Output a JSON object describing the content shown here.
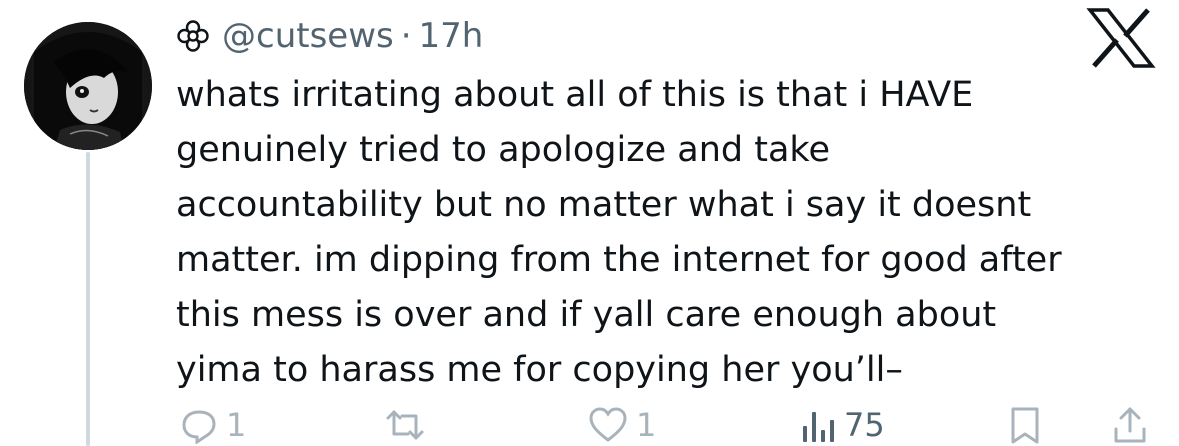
{
  "tweet": {
    "handle": "@cutsews",
    "separator": "·",
    "time": "17h",
    "text_lines": [
      "whats irritating about all of this is that i HAVE",
      "genuinely tried to apologize and take",
      "accountability but no matter what i say it doesnt",
      "matter. im dipping from the internet for good after",
      "this mess is over and if yall care enough about",
      "yima to harass me for copying her you’ll–"
    ],
    "actions": {
      "reply_count": "1",
      "retweet_count": "",
      "like_count": "1",
      "view_count": "75"
    }
  },
  "icons": {
    "handle_prefix": "flower-icon",
    "brand": "x-logo-icon",
    "reply": "reply-icon",
    "retweet": "retweet-icon",
    "like": "heart-icon",
    "views": "views-chart-icon",
    "bookmark": "bookmark-icon",
    "share": "share-icon"
  },
  "colors": {
    "text": "#0f1419",
    "secondary": "#536471",
    "action_faded": "#a8b3bb",
    "thread_line": "#cfd9de"
  }
}
